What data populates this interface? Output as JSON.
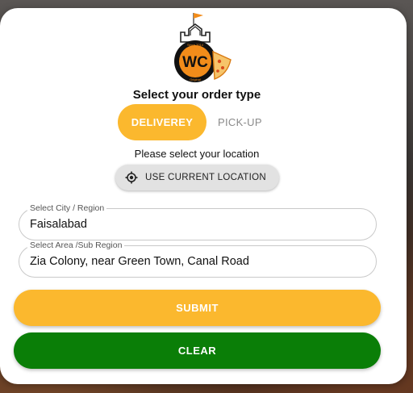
{
  "logo": {
    "initials": "WC",
    "ring_top": "Since 2014",
    "ring_bottom": "Original",
    "colors": {
      "orange": "#f28c1a",
      "ring": "#111111"
    }
  },
  "order": {
    "title": "Select your order type",
    "delivery_label": "DELIVEREY",
    "pickup_label": "PICK-UP",
    "selected": "DELIVEREY"
  },
  "location": {
    "prompt": "Please select your location",
    "use_current_label": "USE CURRENT LOCATION",
    "icon": "crosshair-icon"
  },
  "form": {
    "city_label": "Select City / Region",
    "city_value": "Faisalabad",
    "area_label": "Select Area /Sub Region",
    "area_value": "Zia Colony, near Green Town, Canal Road"
  },
  "actions": {
    "submit_label": "SUBMIT",
    "clear_label": "CLEAR"
  },
  "colors": {
    "accent_yellow": "#fbb82e",
    "clear_green": "#0a7e07",
    "pickup_gray": "#8a8a8a"
  }
}
